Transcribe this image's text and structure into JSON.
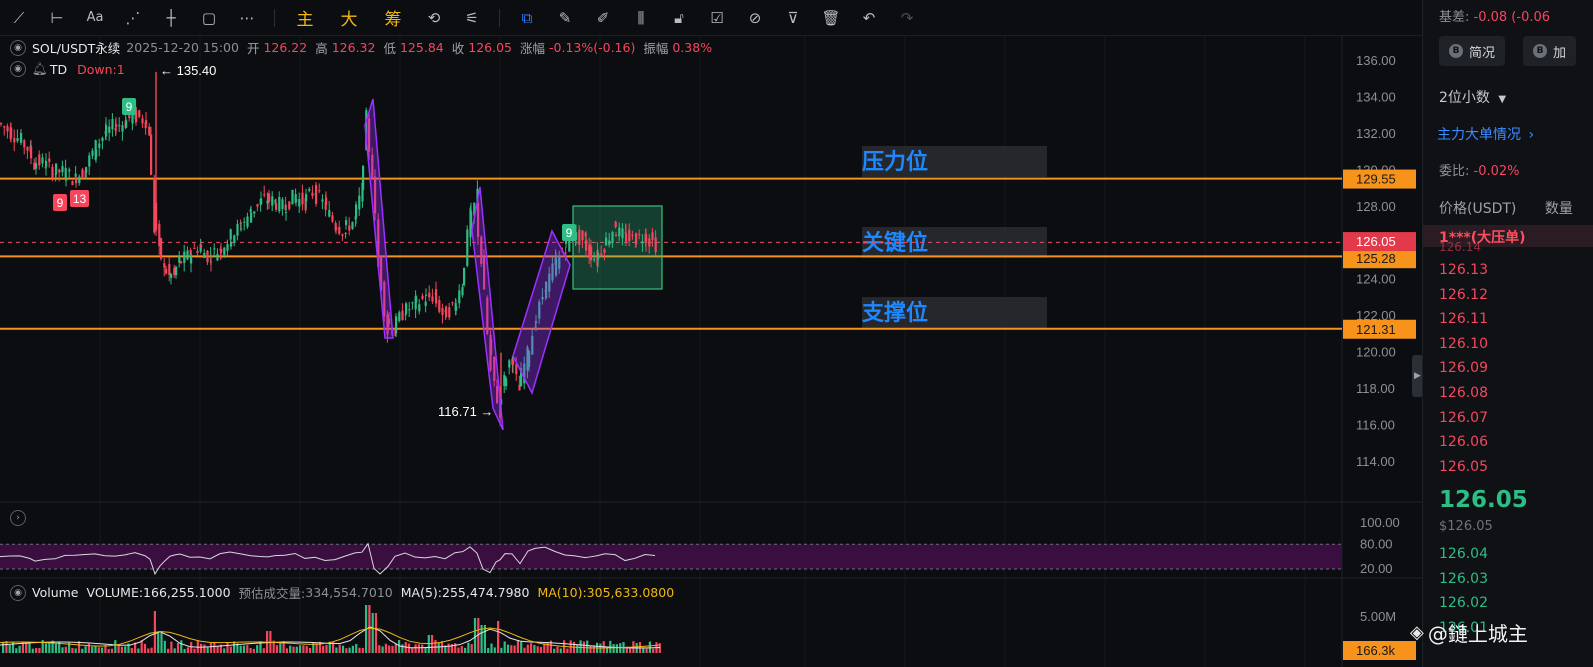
{
  "toolbar": {
    "left_icons": [
      "trend-line-icon",
      "horizontal-line-icon",
      "text-tool-icon",
      "fib-tool-icon",
      "cross-line-icon",
      "rectangle-icon",
      "more-icon"
    ],
    "words": [
      "主",
      "大",
      "筹"
    ],
    "right_icons": [
      "replay-icon",
      "indicator-icon",
      "magnet-icon",
      "ruler-icon",
      "brush-icon",
      "candle-style-icon",
      "lock-icon",
      "note-icon",
      "link-icon",
      "filter-icon",
      "trash-icon",
      "undo-icon",
      "redo-icon"
    ]
  },
  "legend": {
    "symbol": "SOL/USDT永续",
    "datetime": "2025-12-20 15:00",
    "open_label": "开",
    "open": "126.22",
    "high_label": "高",
    "high": "126.32",
    "low_label": "低",
    "low": "125.84",
    "close_label": "收",
    "close": "126.05",
    "change_label": "涨幅",
    "change": "-0.13%(-0.16)",
    "amp_label": "振幅",
    "amp": "0.38%",
    "td_label": "TD",
    "td_down": "Down:1"
  },
  "volume_legend": {
    "name": "Volume",
    "volume": "VOLUME:166,255.1000",
    "est_label": "预估成交量:",
    "est": "334,554.7010",
    "ma5": "MA(5):255,474.7980",
    "ma10": "MA(10):305,633.0800"
  },
  "annotations": {
    "pressure": "压力位",
    "key": "关键位",
    "support": "支撑位",
    "high_marker": "← 135.40",
    "low_marker": "116.71 →",
    "td_counts": [
      "9",
      "9",
      "13",
      "9"
    ]
  },
  "price_tags": {
    "pressure": "129.55",
    "current": "126.05",
    "key": "125.28",
    "support": "121.31",
    "volume_last": "166.3k"
  },
  "colors": {
    "background": "#0b0d10",
    "up": "#2ebd85",
    "down": "#f6465d",
    "level_line": "#f7931a",
    "annotation_text": "#1e88ff",
    "pattern": "#9b30ff",
    "rsi_band": "#3a0f3f"
  },
  "right_panel": {
    "basis_label": "基差:",
    "basis": "-0.08 (-0.06",
    "btn_overview": "简况",
    "btn_add": "加",
    "decimals": "2位小数",
    "big_orders": "主力大单情况",
    "ratio_label": "委比:",
    "ratio": "-0.02%",
    "price_header": "价格(USDT)",
    "qty_header": "数量",
    "big_ask": "1***(大压单)",
    "big_ask_price": "126.14",
    "asks": [
      "126.13",
      "126.12",
      "126.11",
      "126.10",
      "126.09",
      "126.08",
      "126.07",
      "126.06",
      "126.05"
    ],
    "last": "126.05",
    "last_usd": "$126.05",
    "bids": [
      "126.04",
      "126.03",
      "126.02",
      "126.01"
    ]
  },
  "watermark": "@鏈上城主",
  "chart_data": {
    "type": "candlestick",
    "symbol": "SOL/USDT永续",
    "y_axis": {
      "ticks": [
        136.0,
        134.0,
        132.0,
        130.0,
        128.0,
        126.0,
        124.0,
        122.0,
        120.0,
        118.0,
        116.0,
        114.0
      ],
      "range": [
        113.0,
        137.0
      ]
    },
    "levels": [
      {
        "name": "压力位",
        "price": 129.55
      },
      {
        "name": "关键位",
        "price": 125.28
      },
      {
        "name": "支撑位",
        "price": 121.31
      }
    ],
    "current_price": 126.05,
    "marked_high": 135.4,
    "marked_low": 116.71,
    "path_points": [
      [
        0,
        132.6
      ],
      [
        10,
        132.2
      ],
      [
        20,
        131.8
      ],
      [
        30,
        131.2
      ],
      [
        35,
        130.5
      ],
      [
        45,
        130.4
      ],
      [
        55,
        130.0
      ],
      [
        65,
        129.9
      ],
      [
        75,
        129.6
      ],
      [
        85,
        129.9
      ],
      [
        95,
        131.0
      ],
      [
        105,
        131.9
      ],
      [
        115,
        132.4
      ],
      [
        125,
        132.6
      ],
      [
        135,
        133.0
      ],
      [
        145,
        132.8
      ],
      [
        150,
        132.3
      ],
      [
        155,
        128.0
      ],
      [
        160,
        126.0
      ],
      [
        165,
        124.8
      ],
      [
        170,
        124.3
      ],
      [
        175,
        124.2
      ],
      [
        180,
        124.9
      ],
      [
        190,
        125.3
      ],
      [
        200,
        125.8
      ],
      [
        210,
        125.3
      ],
      [
        220,
        125.6
      ],
      [
        230,
        126.2
      ],
      [
        240,
        126.8
      ],
      [
        250,
        127.5
      ],
      [
        260,
        128.2
      ],
      [
        268,
        128.4
      ],
      [
        275,
        128.3
      ],
      [
        285,
        128.0
      ],
      [
        295,
        128.5
      ],
      [
        305,
        128.3
      ],
      [
        315,
        128.8
      ],
      [
        325,
        128.2
      ],
      [
        335,
        127.2
      ],
      [
        345,
        126.7
      ],
      [
        355,
        127.2
      ],
      [
        362,
        128.5
      ],
      [
        368,
        132.6
      ],
      [
        374,
        130.0
      ],
      [
        380,
        125.0
      ],
      [
        388,
        121.8
      ],
      [
        395,
        121.3
      ],
      [
        405,
        122.2
      ],
      [
        415,
        122.6
      ],
      [
        425,
        122.9
      ],
      [
        435,
        123.1
      ],
      [
        445,
        122.1
      ],
      [
        455,
        122.5
      ],
      [
        463,
        123.6
      ],
      [
        470,
        126.6
      ],
      [
        477,
        128.2
      ],
      [
        483,
        125.2
      ],
      [
        490,
        120.6
      ],
      [
        496,
        118.5
      ],
      [
        500,
        117.2
      ],
      [
        505,
        118.2
      ],
      [
        512,
        119.6
      ],
      [
        520,
        118.2
      ],
      [
        528,
        119.6
      ],
      [
        535,
        121.2
      ],
      [
        545,
        123.2
      ],
      [
        555,
        124.6
      ],
      [
        565,
        125.6
      ],
      [
        575,
        126.4
      ],
      [
        585,
        126.2
      ],
      [
        590,
        125.6
      ],
      [
        597,
        125.2
      ],
      [
        605,
        125.8
      ],
      [
        615,
        126.8
      ],
      [
        625,
        126.4
      ],
      [
        635,
        126.2
      ],
      [
        645,
        126.4
      ],
      [
        655,
        126.05
      ]
    ],
    "rsi": {
      "levels": [
        100.0,
        80.0,
        20.0
      ]
    },
    "volume": {
      "axis_label": "5.00M",
      "last": "166.3k"
    }
  }
}
